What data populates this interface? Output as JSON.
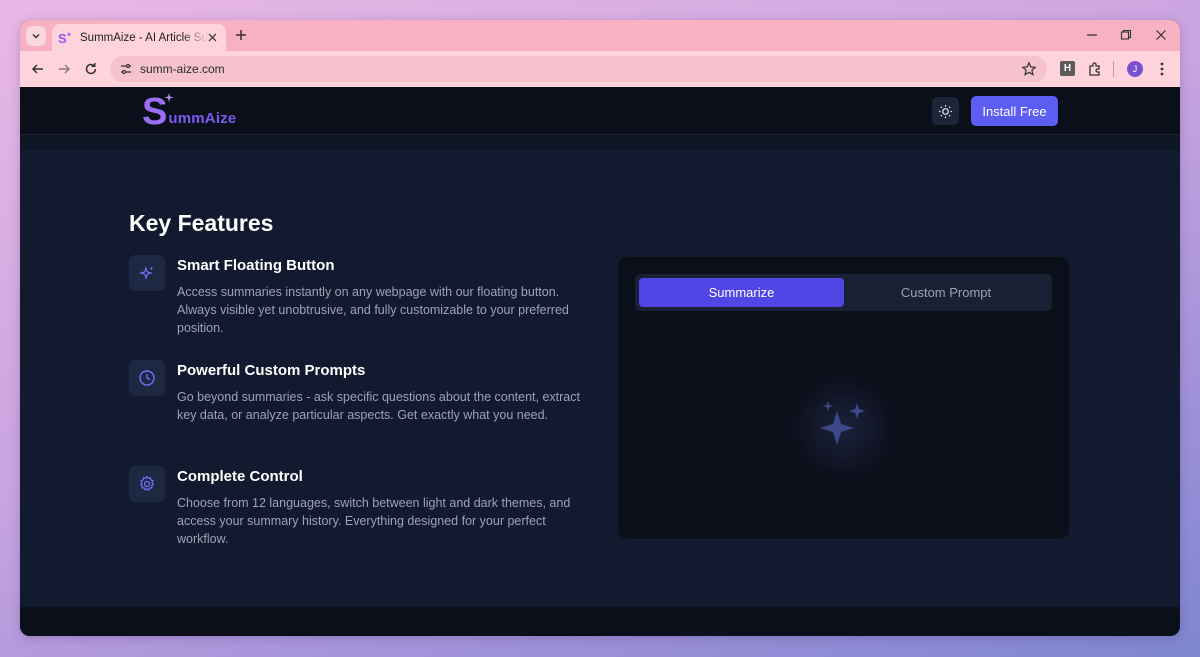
{
  "browser": {
    "tab_title": "SummAize - AI Article Summarizer",
    "url": "summ-aize.com",
    "extension_label": "H",
    "profile_initial": "J"
  },
  "header": {
    "logo_s": "S",
    "logo_text": "ummAize",
    "install_label": "Install Free"
  },
  "features": {
    "title": "Key Features",
    "items": [
      {
        "title": "Smart Floating Button",
        "description": "Access summaries instantly on any webpage with our floating button. Always visible yet unobtrusive, and fully customizable to your preferred position.",
        "icon": "sparkles-icon"
      },
      {
        "title": "Powerful Custom Prompts",
        "description": "Go beyond summaries - ask specific questions about the content, extract key data, or analyze particular aspects. Get exactly what you need.",
        "icon": "clock-icon"
      },
      {
        "title": "Complete Control",
        "description": "Choose from 12 languages, switch between light and dark themes, and access your summary history. Everything designed for your perfect workflow.",
        "icon": "gear-icon"
      }
    ]
  },
  "demo": {
    "tab_active": "Summarize",
    "tab_other": "Custom Prompt"
  },
  "colors": {
    "accent": "#5b5ef0",
    "page_bg": "#111a2e",
    "header_bg": "#0b0f1a",
    "brand_purple": "#9b6ef3"
  }
}
